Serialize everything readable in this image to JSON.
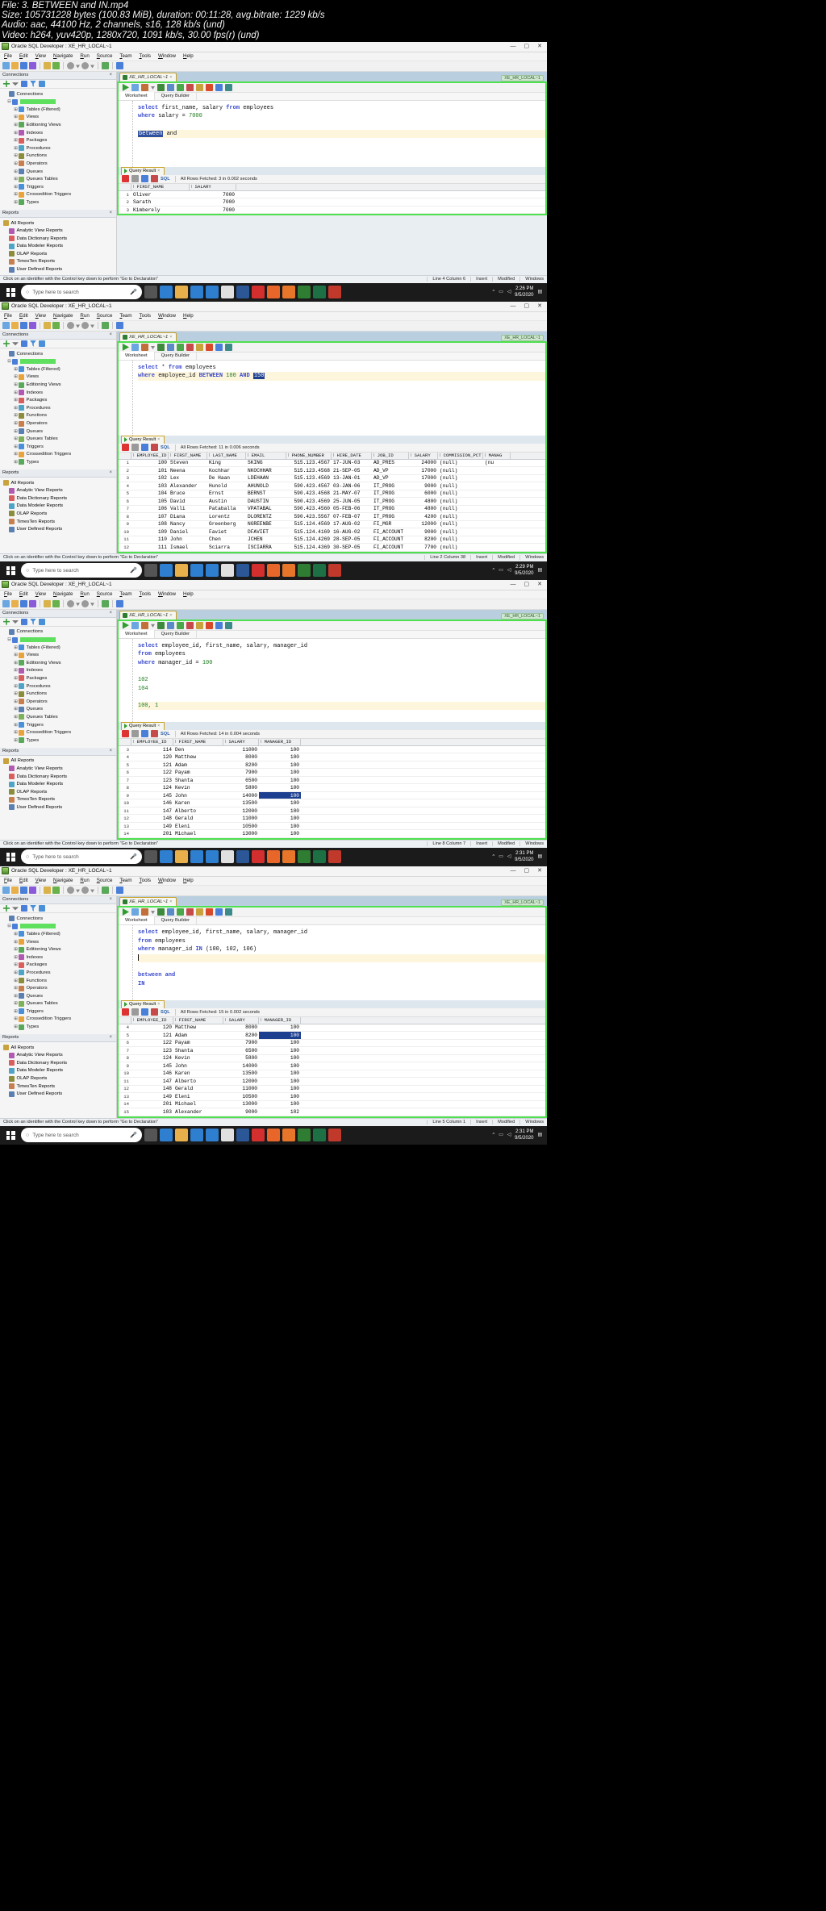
{
  "video_info": {
    "line1": "File: 3. BETWEEN and IN.mp4",
    "line2": "Size: 105731228 bytes (100.83 MiB), duration: 00:11:28, avg.bitrate: 1229 kb/s",
    "line3": "Audio: aac, 44100 Hz, 2 channels, s16, 128 kb/s (und)",
    "line4": "Video: h264, yuv420p, 1280x720, 1091 kb/s, 30.00 fps(r) (und)"
  },
  "app": {
    "title": "Oracle SQL Developer : XE_HR_LOCAL~1",
    "menus": [
      "File",
      "Edit",
      "View",
      "Navigate",
      "Run",
      "Source",
      "Team",
      "Tools",
      "Window",
      "Help"
    ],
    "win_buttons": [
      "minimize",
      "maximize",
      "close"
    ],
    "connections_panel": "Connections",
    "reports_panel": "Reports",
    "worksheet_tab": "XE_HR_LOCAL~1",
    "conn_badge": "XE_HR_LOCAL~1",
    "sub_tabs": [
      "Worksheet",
      "Query Builder"
    ],
    "query_result_tab": "Query Result",
    "status_hint": "Click on an identifier with the Control key down to perform \"Go to Declaration\"",
    "status_insert": "Insert",
    "status_modified": "Modified",
    "status_windows": "Windows"
  },
  "tree": {
    "root": "Connections",
    "connection": "XE_HR_LOCAL",
    "nodes": [
      "Tables (Filtered)",
      "Views",
      "Editioning Views",
      "Indexes",
      "Packages",
      "Procedures",
      "Functions",
      "Operators",
      "Queues",
      "Queues Tables",
      "Triggers",
      "Crossedition Triggers",
      "Types"
    ]
  },
  "reports": {
    "root": "All Reports",
    "items": [
      "Analytic View Reports",
      "Data Dictionary Reports",
      "Data Modeler Reports",
      "OLAP Reports",
      "TimesTen Reports",
      "User Defined Reports"
    ]
  },
  "taskbar": {
    "search_placeholder": "Type here to search",
    "icons": [
      "cortana-icon",
      "task-view-icon",
      "edge-icon",
      "file-explorer-icon",
      "store-icon",
      "mail-icon",
      "chrome-icon",
      "word-icon",
      "acrobat-icon",
      "firefox-icon",
      "vlc-icon",
      "sqldeveloper-icon",
      "excel-icon",
      "c-icon"
    ],
    "tray": [
      "show-hidden-icons",
      "network-icon",
      "volume-icon",
      "battery-icon"
    ]
  },
  "shots": [
    {
      "id": "shot-1",
      "sql_lines": [
        {
          "text": "select first_name, salary from employees",
          "type": "plain"
        },
        {
          "text": "where salary = 7000",
          "type": "plain"
        },
        {
          "text": "",
          "type": "plain"
        },
        {
          "text": "between and",
          "type": "highlight-selected"
        }
      ],
      "code": {
        "l1_kw1": "select",
        "l1_rest": " first_name, salary ",
        "l1_kw2": "from",
        "l1_tail": " employees",
        "l2_kw": "where",
        "l2_mid": " salary = ",
        "l2_num": "7000",
        "l4_sel": "between",
        "l4_rest": " and"
      },
      "result": {
        "fetch_status": "All Rows Fetched: 3 in 0.002 seconds",
        "columns": [
          "FIRST_NAME",
          "SALARY"
        ],
        "rows": [
          {
            "idx": "1",
            "cells": [
              "Oliver",
              "7000"
            ]
          },
          {
            "idx": "2",
            "cells": [
              "Sarath",
              "7000"
            ]
          },
          {
            "idx": "3",
            "cells": [
              "Kimberely",
              "7000"
            ]
          }
        ]
      },
      "status_position": "Line 4 Column 6",
      "clock_time": "2:26 PM",
      "clock_date": "9/5/2020"
    },
    {
      "id": "shot-2",
      "code": {
        "l1_kw1": "select",
        "l1_mid": " * ",
        "l1_kw2": "from",
        "l1_tail": " employees",
        "l2_kw": "where",
        "l2_mid": " employee_id ",
        "l2_kw2": "BETWEEN",
        "l2_num1": " 100 ",
        "l2_kw3": "AND",
        "l2_sel": "150"
      },
      "result": {
        "fetch_status": "All Rows Fetched: 11 in 0.006 seconds",
        "columns": [
          "EMPLOYEE_ID",
          "FIRST_NAME",
          "LAST_NAME",
          "EMAIL",
          "PHONE_NUMBER",
          "HIRE_DATE",
          "JOB_ID",
          "SALARY",
          "COMMISSION_PCT",
          "MANAG"
        ],
        "rows": [
          {
            "idx": "1",
            "cells": [
              "100",
              "Steven",
              "King",
              "SKING",
              "515.123.4567",
              "17-JUN-03",
              "AD_PRES",
              "24000",
              "(null)",
              "(nu"
            ]
          },
          {
            "idx": "2",
            "cells": [
              "101",
              "Neena",
              "Kochhar",
              "NKOCHHAR",
              "515.123.4568",
              "21-SEP-05",
              "AD_VP",
              "17000",
              "(null)",
              ""
            ]
          },
          {
            "idx": "3",
            "cells": [
              "102",
              "Lex",
              "De Haan",
              "LDEHAAN",
              "515.123.4569",
              "13-JAN-01",
              "AD_VP",
              "17000",
              "(null)",
              ""
            ]
          },
          {
            "idx": "4",
            "cells": [
              "103",
              "Alexander",
              "Hunold",
              "AHUNOLD",
              "590.423.4567",
              "03-JAN-06",
              "IT_PROG",
              "9000",
              "(null)",
              ""
            ]
          },
          {
            "idx": "5",
            "cells": [
              "104",
              "Bruce",
              "Ernst",
              "BERNST",
              "590.423.4568",
              "21-MAY-07",
              "IT_PROG",
              "6000",
              "(null)",
              ""
            ]
          },
          {
            "idx": "6",
            "cells": [
              "105",
              "David",
              "Austin",
              "DAUSTIN",
              "590.423.4569",
              "25-JUN-05",
              "IT_PROG",
              "4800",
              "(null)",
              ""
            ]
          },
          {
            "idx": "7",
            "cells": [
              "106",
              "Valli",
              "Pataballa",
              "VPATABAL",
              "590.423.4560",
              "05-FEB-06",
              "IT_PROG",
              "4800",
              "(null)",
              ""
            ]
          },
          {
            "idx": "8",
            "cells": [
              "107",
              "Diana",
              "Lorentz",
              "DLORENTZ",
              "590.423.5567",
              "07-FEB-07",
              "IT_PROG",
              "4200",
              "(null)",
              ""
            ]
          },
          {
            "idx": "9",
            "cells": [
              "108",
              "Nancy",
              "Greenberg",
              "NGREENBE",
              "515.124.4569",
              "17-AUG-02",
              "FI_MGR",
              "12000",
              "(null)",
              ""
            ]
          },
          {
            "idx": "10",
            "cells": [
              "109",
              "Daniel",
              "Faviet",
              "DFAVIET",
              "515.124.4169",
              "16-AUG-02",
              "FI_ACCOUNT",
              "9000",
              "(null)",
              ""
            ]
          },
          {
            "idx": "11",
            "cells": [
              "110",
              "John",
              "Chen",
              "JCHEN",
              "515.124.4269",
              "28-SEP-05",
              "FI_ACCOUNT",
              "8200",
              "(null)",
              ""
            ]
          },
          {
            "idx": "12",
            "cells": [
              "111",
              "Ismael",
              "Sciarra",
              "ISCIARRA",
              "515.124.4369",
              "30-SEP-05",
              "FI_ACCOUNT",
              "7700",
              "(null)",
              ""
            ]
          }
        ]
      },
      "status_position": "Line 2 Column 38",
      "clock_time": "2:29 PM",
      "clock_date": "9/5/2020"
    },
    {
      "id": "shot-3",
      "code": {
        "l1_kw1": "select",
        "l1_rest": " employee_id, first_name, salary, manager_id",
        "l2_kw": "from",
        "l2_rest": " employees",
        "l3_kw": "where",
        "l3_rest": " manager_id = ",
        "l3_num": "100",
        "l5": "102",
        "l6": "104",
        "l8": "100, 1"
      },
      "result": {
        "fetch_status": "All Rows Fetched: 14 in 0.004 seconds",
        "columns": [
          "EMPLOYEE_ID",
          "FIRST_NAME",
          "SALARY",
          "MANAGER_ID"
        ],
        "rows": [
          {
            "idx": "3",
            "cells": [
              "114",
              "Den",
              "11000",
              "100"
            ]
          },
          {
            "idx": "4",
            "cells": [
              "120",
              "Matthew",
              "8000",
              "100"
            ]
          },
          {
            "idx": "5",
            "cells": [
              "121",
              "Adam",
              "8200",
              "100"
            ]
          },
          {
            "idx": "6",
            "cells": [
              "122",
              "Payam",
              "7900",
              "100"
            ]
          },
          {
            "idx": "7",
            "cells": [
              "123",
              "Shanta",
              "6500",
              "100"
            ]
          },
          {
            "idx": "8",
            "cells": [
              "124",
              "Kevin",
              "5800",
              "100"
            ]
          },
          {
            "idx": "9",
            "cells": [
              "145",
              "John",
              "14000",
              "100"
            ],
            "sel": 3
          },
          {
            "idx": "10",
            "cells": [
              "146",
              "Karen",
              "13500",
              "100"
            ]
          },
          {
            "idx": "11",
            "cells": [
              "147",
              "Alberto",
              "12000",
              "100"
            ]
          },
          {
            "idx": "12",
            "cells": [
              "148",
              "Gerald",
              "11000",
              "100"
            ]
          },
          {
            "idx": "13",
            "cells": [
              "149",
              "Eleni",
              "10500",
              "100"
            ]
          },
          {
            "idx": "14",
            "cells": [
              "201",
              "Michael",
              "13000",
              "100"
            ]
          }
        ]
      },
      "status_position": "Line 8 Column 7",
      "clock_time": "2:31 PM",
      "clock_date": "9/5/2020"
    },
    {
      "id": "shot-4",
      "code": {
        "l1_kw1": "select",
        "l1_rest": " employee_id, first_name, salary, manager_id",
        "l2_kw": "from",
        "l2_rest": " employees",
        "l3_kw": "where",
        "l3_mid": " manager_id ",
        "l3_kw2": "IN",
        "l3_rest": " (100, 102, 106)",
        "l6": "between and",
        "l7": "IN"
      },
      "result": {
        "fetch_status": "All Rows Fetched: 15 in 0.002 seconds",
        "columns": [
          "EMPLOYEE_ID",
          "FIRST_NAME",
          "SALARY",
          "MANAGER_ID"
        ],
        "rows": [
          {
            "idx": "4",
            "cells": [
              "120",
              "Matthew",
              "8000",
              "100"
            ]
          },
          {
            "idx": "5",
            "cells": [
              "121",
              "Adam",
              "8200",
              "100"
            ],
            "sel": 3
          },
          {
            "idx": "6",
            "cells": [
              "122",
              "Payam",
              "7900",
              "100"
            ]
          },
          {
            "idx": "7",
            "cells": [
              "123",
              "Shanta",
              "6500",
              "100"
            ]
          },
          {
            "idx": "8",
            "cells": [
              "124",
              "Kevin",
              "5800",
              "100"
            ]
          },
          {
            "idx": "9",
            "cells": [
              "145",
              "John",
              "14000",
              "100"
            ]
          },
          {
            "idx": "10",
            "cells": [
              "146",
              "Karen",
              "13500",
              "100"
            ]
          },
          {
            "idx": "11",
            "cells": [
              "147",
              "Alberto",
              "12000",
              "100"
            ]
          },
          {
            "idx": "12",
            "cells": [
              "148",
              "Gerald",
              "11000",
              "100"
            ]
          },
          {
            "idx": "13",
            "cells": [
              "149",
              "Eleni",
              "10500",
              "100"
            ]
          },
          {
            "idx": "14",
            "cells": [
              "201",
              "Michael",
              "13000",
              "100"
            ]
          },
          {
            "idx": "15",
            "cells": [
              "103",
              "Alexander",
              "9000",
              "102"
            ]
          }
        ]
      },
      "status_position": "Line 5 Column 1",
      "clock_time": "2:31 PM",
      "clock_date": "9/5/2020"
    }
  ]
}
